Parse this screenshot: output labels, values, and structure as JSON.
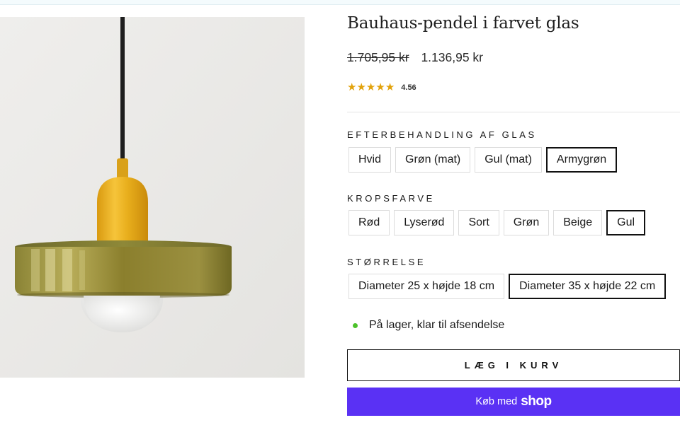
{
  "product": {
    "title": "Bauhaus-pendel i farvet glas",
    "price_old": "1.705,95 kr",
    "price_new": "1.136,95 kr",
    "rating_value": "4.56",
    "rating_stars": 5
  },
  "options": {
    "finish": {
      "label": "EFTERBEHANDLING AF GLAS",
      "values": [
        "Hvid",
        "Grøn (mat)",
        "Gul (mat)",
        "Armygrøn"
      ],
      "selected": "Armygrøn"
    },
    "body_color": {
      "label": "KROPSFARVE",
      "values": [
        "Rød",
        "Lyserød",
        "Sort",
        "Grøn",
        "Beige",
        "Gul"
      ],
      "selected": "Gul"
    },
    "size": {
      "label": "STØRRELSE",
      "values": [
        "Diameter 25 x højde 18 cm",
        "Diameter 35 x højde 22 cm"
      ],
      "selected": "Diameter 35 x højde 22 cm"
    }
  },
  "stock": {
    "text": "På lager, klar til afsendelse",
    "color": "#4cc22a"
  },
  "buttons": {
    "add_to_cart": "LÆG I KURV",
    "shop_pay_prefix": "Køb med",
    "shop_pay_logo": "shop"
  },
  "colors": {
    "accent": "#5a31f4",
    "star": "#e2a20b"
  }
}
